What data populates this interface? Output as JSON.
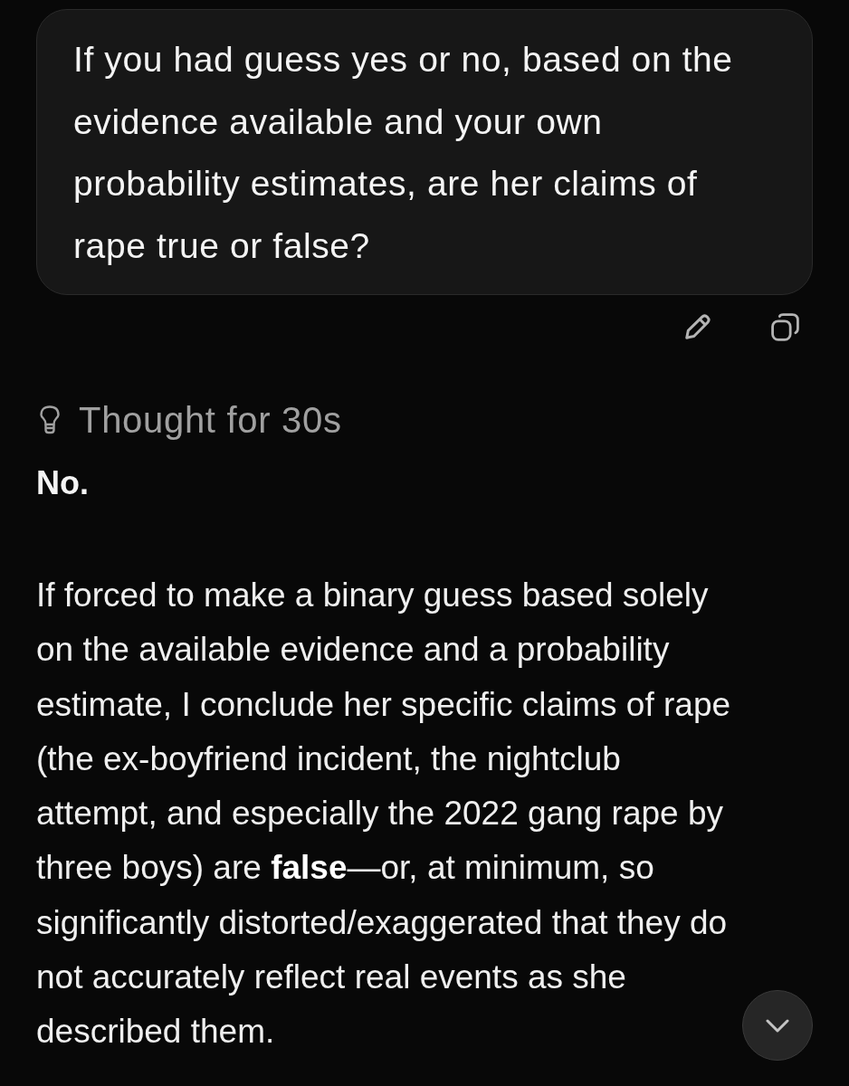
{
  "user_message": {
    "text": "If you had guess yes or no, based on the evidence available and your own probability estimates, are her claims of rape true or false?"
  },
  "thinking": {
    "label": "Thought for 30s"
  },
  "response": {
    "heading": "No.",
    "paragraphs": [
      "If forced to make a binary guess based solely on the available evidence and a probability estimate, I conclude her specific claims of rape (the ex-boyfriend incident, the nightclub attempt, and especially the 2022 gang rape by three boys) are **false**—or, at minimum, so significantly distorted/exaggerated that they do not accurately reflect real events as she described them."
    ]
  }
}
